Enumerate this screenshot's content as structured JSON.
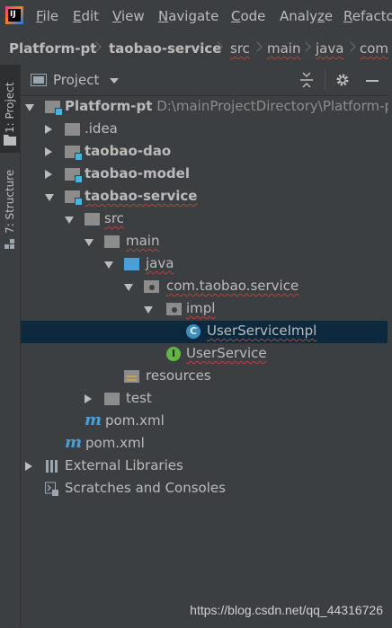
{
  "menu": {
    "items": [
      "File",
      "Edit",
      "View",
      "Navigate",
      "Code",
      "Analyze",
      "Refactor"
    ],
    "underline": [
      "F",
      "E",
      "V",
      "N",
      "C",
      "z",
      "R"
    ]
  },
  "breadcrumb": [
    "Platform-pt",
    "taobao-service",
    "src",
    "main",
    "java",
    "com"
  ],
  "side_tabs": {
    "project": "1: Project",
    "structure": "7: Structure"
  },
  "panel": {
    "title": "Project"
  },
  "tree": {
    "root_name": "Platform-pt",
    "root_path": "D:\\mainProjectDirectory\\Platform-pt",
    "idea": ".idea",
    "dao": "taobao-dao",
    "model": "taobao-model",
    "service": "taobao-service",
    "src": "src",
    "main": "main",
    "java": "java",
    "package": "com.taobao.service",
    "impl": "impl",
    "impl_class": "UserServiceImpl",
    "interface": "UserService",
    "resources": "resources",
    "test": "test",
    "service_pom": "pom.xml",
    "root_pom": "pom.xml",
    "external": "External Libraries",
    "scratches": "Scratches and Consoles"
  },
  "icon_letters": {
    "class": "C",
    "interface": "I",
    "maven": "m"
  },
  "watermark": "https://blog.csdn.net/qq_44316726",
  "colors": {
    "background": "#3c3f41",
    "selection": "#0d293e",
    "text": "#bbbbbb",
    "folder_blue": "#4a9fd4",
    "module_badge": "#40b6e0",
    "class_icon": "#3d8ebd",
    "interface_icon": "#62b543"
  }
}
